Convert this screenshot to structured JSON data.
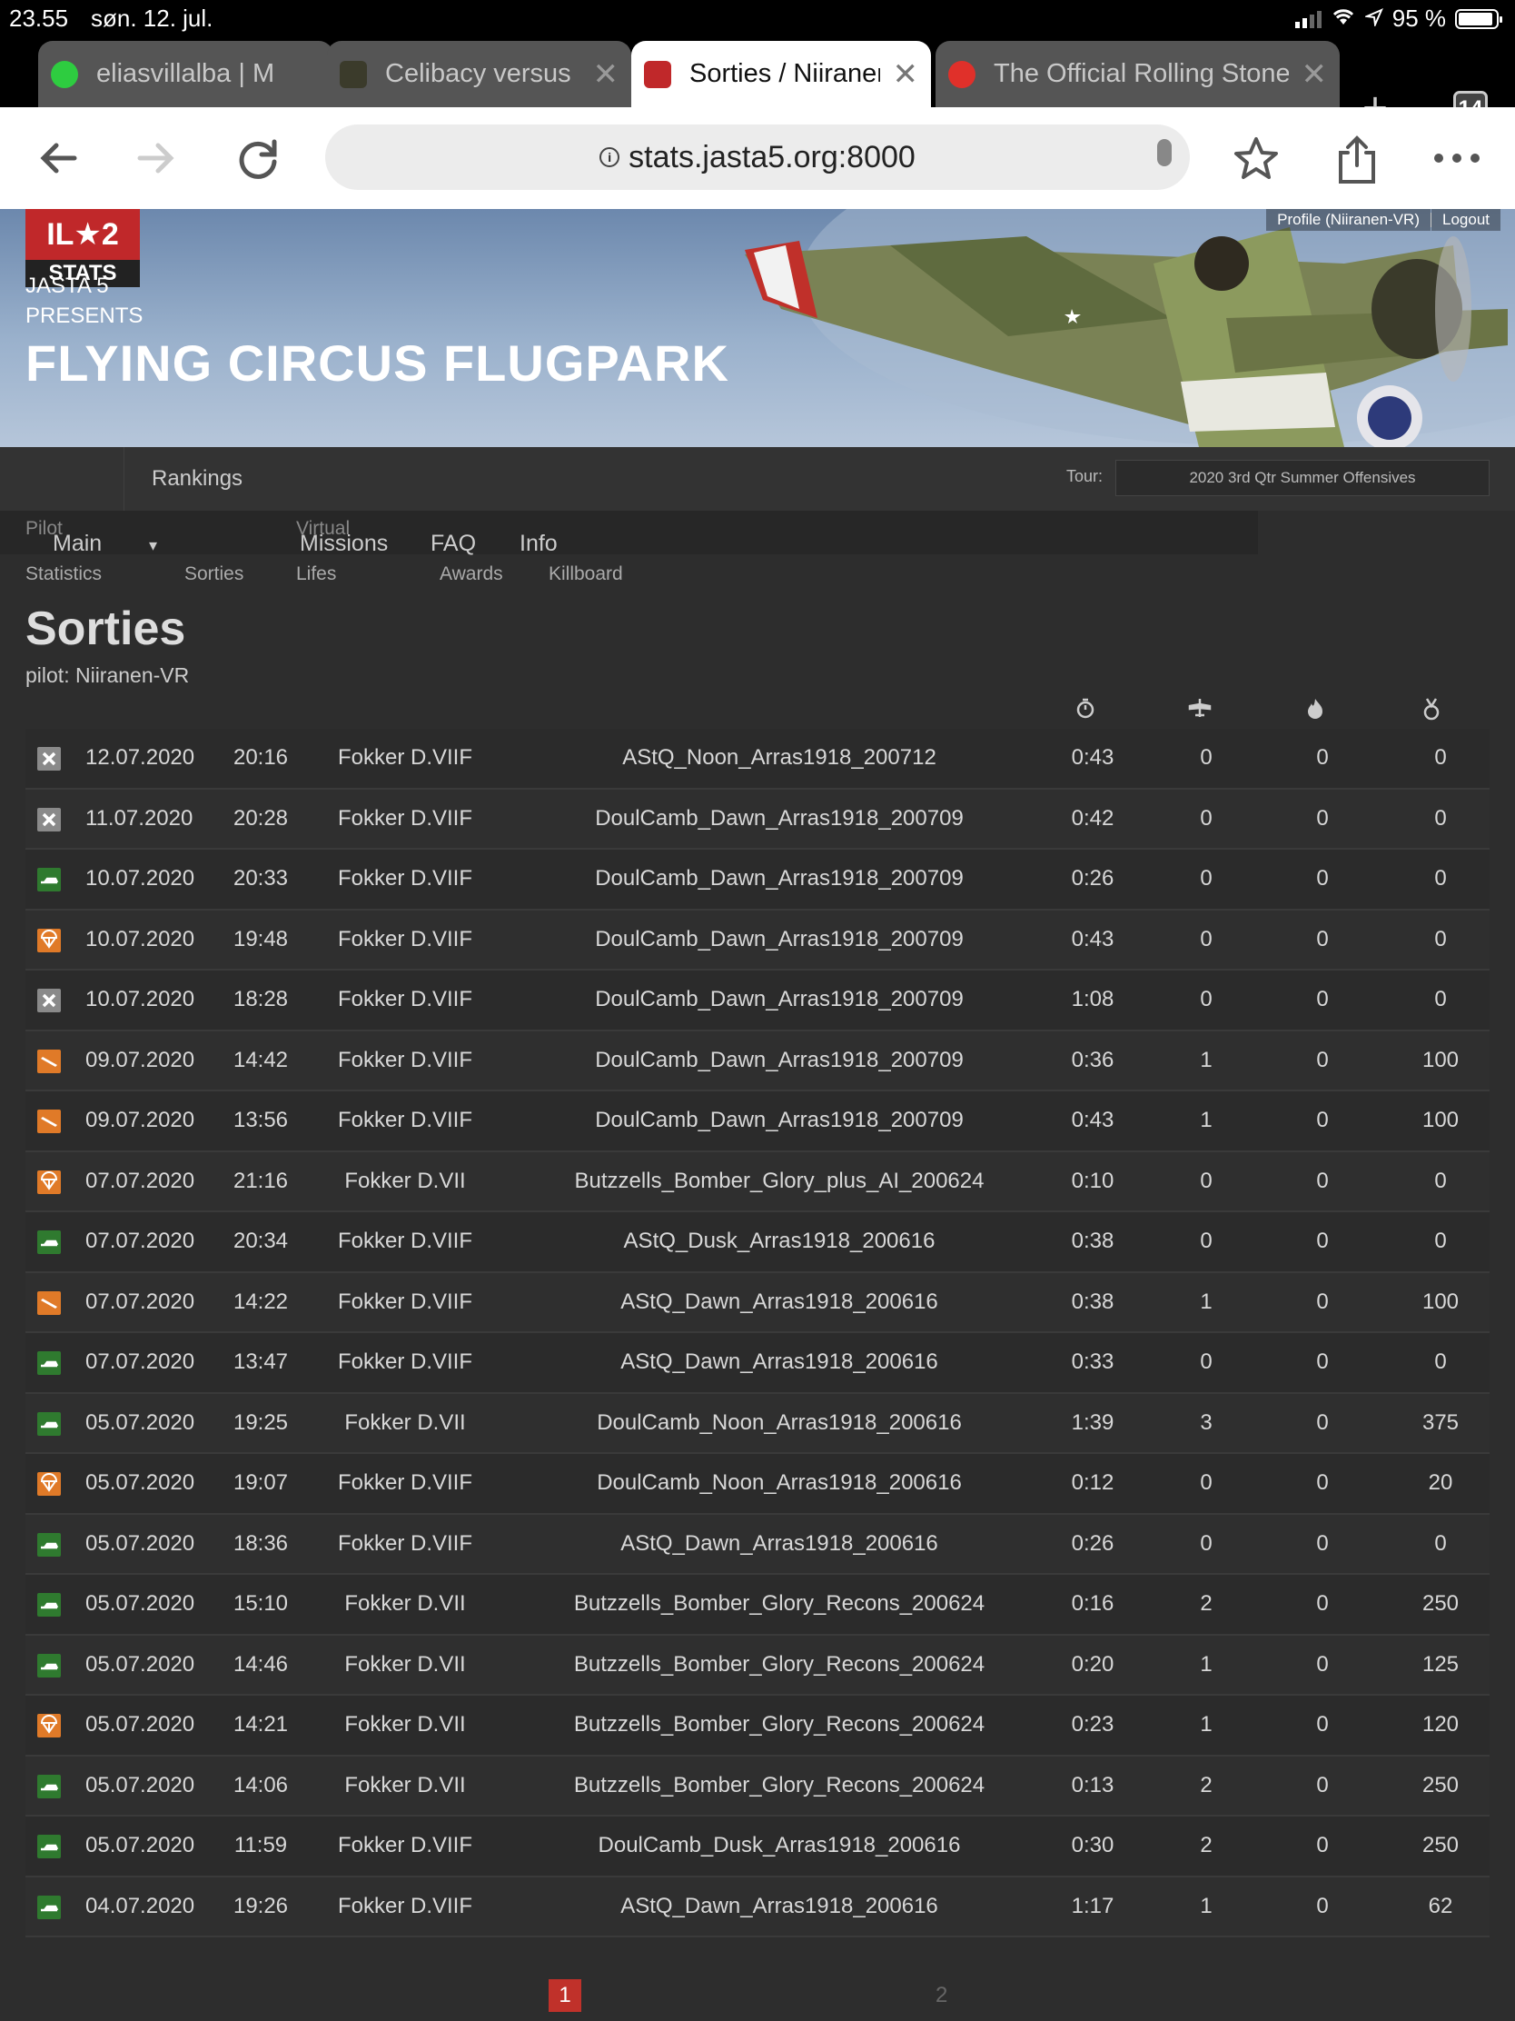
{
  "status_bar": {
    "time": "23.55",
    "date": "søn. 12. jul.",
    "battery": "95 %"
  },
  "tabs": [
    {
      "title": "eliasvillalba | M",
      "favicon_color": "#2ecc40"
    },
    {
      "title": "Celibacy versus",
      "favicon_color": "#3b3b2b"
    },
    {
      "title": "Sorties / Niiranen",
      "favicon_color": "#c0282a",
      "active": true
    },
    {
      "title": "The Official Rolling Stones",
      "favicon_color": "#e0302a"
    }
  ],
  "tab_count": "14",
  "url": "stats.jasta5.org:8000",
  "header": {
    "logo_top": "IL★2",
    "logo_bottom": "STATS",
    "presenter_line1": "JASTA 5",
    "presenter_line2": "PRESENTS",
    "title": "FLYING CIRCUS FLUGPARK",
    "profile_link": "Profile (Niiranen-VR)",
    "logout_link": "Logout"
  },
  "nav": {
    "rankings": "Rankings",
    "tour_label": "Tour:",
    "tour_value": "2020 3rd Qtr Summer Offensives",
    "main": "Main",
    "missions": "Missions",
    "faq": "FAQ",
    "info": "Info",
    "pilot": "Pilot",
    "virtual": "Virtual",
    "statistics": "Statistics",
    "sorties": "Sorties",
    "lifes": "Lifes",
    "awards": "Awards",
    "killboard": "Killboard",
    "dropdown_arrow": "▾"
  },
  "page": {
    "title": "Sorties",
    "pilot_label": "pilot: Niiranen-VR"
  },
  "columns": {
    "duration_icon": "stopwatch-icon",
    "aircraft_kills_icon": "plane-icon",
    "ground_kills_icon": "flame-icon",
    "score_icon": "medal-icon"
  },
  "status_colors": {
    "disco": "#8a8a8a",
    "landed": "#2f7a2f",
    "bailout": "#e07a28",
    "crashed": "#e07a28"
  },
  "sorties": [
    {
      "status": "disco",
      "date": "12.07.2020",
      "time": "20:16",
      "aircraft": "Fokker D.VIIF",
      "mission": "AStQ_Noon_Arras1918_200712",
      "duration": "0:43",
      "ak": "0",
      "gk": "0",
      "score": "0"
    },
    {
      "status": "disco",
      "date": "11.07.2020",
      "time": "20:28",
      "aircraft": "Fokker D.VIIF",
      "mission": "DoulCamb_Dawn_Arras1918_200709",
      "duration": "0:42",
      "ak": "0",
      "gk": "0",
      "score": "0"
    },
    {
      "status": "landed",
      "date": "10.07.2020",
      "time": "20:33",
      "aircraft": "Fokker D.VIIF",
      "mission": "DoulCamb_Dawn_Arras1918_200709",
      "duration": "0:26",
      "ak": "0",
      "gk": "0",
      "score": "0"
    },
    {
      "status": "bailout",
      "date": "10.07.2020",
      "time": "19:48",
      "aircraft": "Fokker D.VIIF",
      "mission": "DoulCamb_Dawn_Arras1918_200709",
      "duration": "0:43",
      "ak": "0",
      "gk": "0",
      "score": "0"
    },
    {
      "status": "disco",
      "date": "10.07.2020",
      "time": "18:28",
      "aircraft": "Fokker D.VIIF",
      "mission": "DoulCamb_Dawn_Arras1918_200709",
      "duration": "1:08",
      "ak": "0",
      "gk": "0",
      "score": "0"
    },
    {
      "status": "crashed",
      "date": "09.07.2020",
      "time": "14:42",
      "aircraft": "Fokker D.VIIF",
      "mission": "DoulCamb_Dawn_Arras1918_200709",
      "duration": "0:36",
      "ak": "1",
      "gk": "0",
      "score": "100"
    },
    {
      "status": "crashed",
      "date": "09.07.2020",
      "time": "13:56",
      "aircraft": "Fokker D.VIIF",
      "mission": "DoulCamb_Dawn_Arras1918_200709",
      "duration": "0:43",
      "ak": "1",
      "gk": "0",
      "score": "100"
    },
    {
      "status": "bailout",
      "date": "07.07.2020",
      "time": "21:16",
      "aircraft": "Fokker D.VII",
      "mission": "Butzzells_Bomber_Glory_plus_AI_200624",
      "duration": "0:10",
      "ak": "0",
      "gk": "0",
      "score": "0"
    },
    {
      "status": "landed",
      "date": "07.07.2020",
      "time": "20:34",
      "aircraft": "Fokker D.VIIF",
      "mission": "AStQ_Dusk_Arras1918_200616",
      "duration": "0:38",
      "ak": "0",
      "gk": "0",
      "score": "0"
    },
    {
      "status": "crashed",
      "date": "07.07.2020",
      "time": "14:22",
      "aircraft": "Fokker D.VIIF",
      "mission": "AStQ_Dawn_Arras1918_200616",
      "duration": "0:38",
      "ak": "1",
      "gk": "0",
      "score": "100"
    },
    {
      "status": "landed",
      "date": "07.07.2020",
      "time": "13:47",
      "aircraft": "Fokker D.VIIF",
      "mission": "AStQ_Dawn_Arras1918_200616",
      "duration": "0:33",
      "ak": "0",
      "gk": "0",
      "score": "0"
    },
    {
      "status": "landed",
      "date": "05.07.2020",
      "time": "19:25",
      "aircraft": "Fokker D.VII",
      "mission": "DoulCamb_Noon_Arras1918_200616",
      "duration": "1:39",
      "ak": "3",
      "gk": "0",
      "score": "375"
    },
    {
      "status": "bailout",
      "date": "05.07.2020",
      "time": "19:07",
      "aircraft": "Fokker D.VIIF",
      "mission": "DoulCamb_Noon_Arras1918_200616",
      "duration": "0:12",
      "ak": "0",
      "gk": "0",
      "score": "20"
    },
    {
      "status": "landed",
      "date": "05.07.2020",
      "time": "18:36",
      "aircraft": "Fokker D.VIIF",
      "mission": "AStQ_Dawn_Arras1918_200616",
      "duration": "0:26",
      "ak": "0",
      "gk": "0",
      "score": "0"
    },
    {
      "status": "landed",
      "date": "05.07.2020",
      "time": "15:10",
      "aircraft": "Fokker D.VII",
      "mission": "Butzzells_Bomber_Glory_Recons_200624",
      "duration": "0:16",
      "ak": "2",
      "gk": "0",
      "score": "250"
    },
    {
      "status": "landed",
      "date": "05.07.2020",
      "time": "14:46",
      "aircraft": "Fokker D.VII",
      "mission": "Butzzells_Bomber_Glory_Recons_200624",
      "duration": "0:20",
      "ak": "1",
      "gk": "0",
      "score": "125"
    },
    {
      "status": "bailout",
      "date": "05.07.2020",
      "time": "14:21",
      "aircraft": "Fokker D.VII",
      "mission": "Butzzells_Bomber_Glory_Recons_200624",
      "duration": "0:23",
      "ak": "1",
      "gk": "0",
      "score": "120"
    },
    {
      "status": "landed",
      "date": "05.07.2020",
      "time": "14:06",
      "aircraft": "Fokker D.VII",
      "mission": "Butzzells_Bomber_Glory_Recons_200624",
      "duration": "0:13",
      "ak": "2",
      "gk": "0",
      "score": "250"
    },
    {
      "status": "landed",
      "date": "05.07.2020",
      "time": "11:59",
      "aircraft": "Fokker D.VIIF",
      "mission": "DoulCamb_Dusk_Arras1918_200616",
      "duration": "0:30",
      "ak": "2",
      "gk": "0",
      "score": "250"
    },
    {
      "status": "landed",
      "date": "04.07.2020",
      "time": "19:26",
      "aircraft": "Fokker D.VIIF",
      "mission": "AStQ_Dawn_Arras1918_200616",
      "duration": "1:17",
      "ak": "1",
      "gk": "0",
      "score": "62"
    }
  ],
  "pagination": {
    "current": "1",
    "next": "2"
  }
}
